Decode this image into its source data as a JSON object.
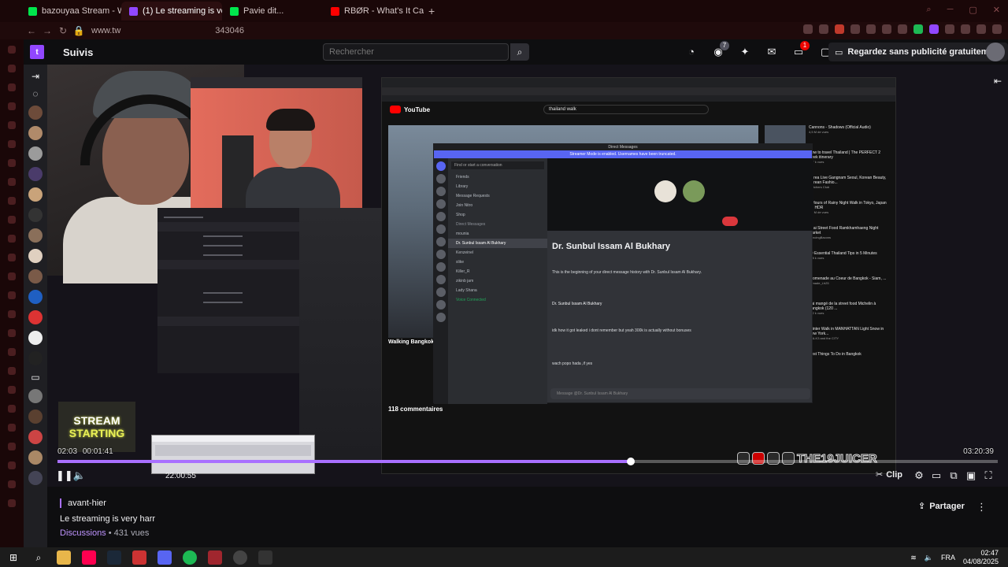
{
  "browser": {
    "tabs": [
      {
        "label": "bazouyaa Stream - Watch",
        "favicon_color": "#00e64d"
      },
      {
        "label": "(1) Le streaming is ver",
        "favicon_color": "#9147ff"
      },
      {
        "label": "Pavie dit...",
        "favicon_color": "#00e64d"
      },
      {
        "label": "RBØR - What's It Called (",
        "favicon_color": "#ff0000"
      }
    ],
    "new_tab": "+",
    "url_left": "www.tw",
    "url_right": "343046"
  },
  "twitch": {
    "nav": {
      "follow_label": "Suivis",
      "search_placeholder": "Rechercher",
      "notifications_count": "7",
      "inbox_count": "1",
      "prime_label": "Regardez sans publicité gratuitement"
    },
    "player": {
      "overlay_card_line1": "STREAM",
      "overlay_card_line2": "STARTING",
      "hover_time": "00:01:41",
      "elapsed_overlay": "02:03",
      "current_time": "22:00:55",
      "duration": "03:20:39",
      "progress": 0.61,
      "clip_label": "Clip",
      "watermark": "THE19JUICER"
    },
    "shared_screen": {
      "youtube_word": "YouTube",
      "youtube_search": "thailand walk",
      "video_title": "Walking Bangkok",
      "comments_count": "118 commentaires",
      "recommendations": [
        {
          "title": "Cannons - Shadows (Official Audio)",
          "meta": "4,5 M de vues"
        },
        {
          "title": "How to travel Thailand | The PERFECT 2 week itinerary",
          "meta": "737 k vues"
        },
        {
          "title": "Korea Live Gangnam Seoul, Korean Beauty, Korean Fashio...",
          "meta": "Watchers Club"
        },
        {
          "title": "3 Hours of Rainy Night Walk in Tokyo, Japan 4K HDR",
          "meta": "1,2 M de vues"
        },
        {
          "title": "Thai Street Food Ramkhamhaeng Night Market",
          "meta": "DancingBacons"
        },
        {
          "title": "10 Essential Thailand Tips in 5 Minutes",
          "meta": "148 k vues"
        },
        {
          "title": "Promenade au Coeur de Bangkok - Siam, ...",
          "meta": "nomade_Lh25"
        },
        {
          "title": "J'ai mangé de la street food Michelin à Bangkok (120 ...",
          "meta": "922 k vues"
        },
        {
          "title": "Winter Walk in MANHATTAN Light Snow in New York...",
          "meta": "WALK3 and the CITY"
        },
        {
          "title": "Best Things To Do in Bangkok",
          "meta": ""
        }
      ],
      "discord": {
        "title_bar": "Direct Messages",
        "banner": "Streamer Mode is enabled. Usernames have been truncated.",
        "find_placeholder": "Find or start a conversation",
        "menu": [
          "Friends",
          "Library",
          "Message Requests",
          "Join Nitro",
          "Shop"
        ],
        "dm_header": "Direct Messages",
        "dms": [
          "mounia",
          "Dr. Sunbul Issam Al Bukhary",
          "Kenzeinel",
          "slike",
          "Killer_R",
          "zikinb jam",
          "Lady Shana"
        ],
        "voice_status": "Voice Connected",
        "chat_name": "Dr. Sunbul Issam Al Bukhary",
        "chat_intro": "This is the beginning of your direct message history with Dr. Sunbul Issam Al Bukhary.",
        "message_1": "Dr. Sunbul Issam Al Bukhary",
        "message_2": "idk how it got leaked i dont remember but yeah 300k is actually without bonuses",
        "message_3": "wach popo hada ,if yes",
        "input_placeholder": "Message @Dr. Sunbul Issam Al Bukhary"
      }
    },
    "info": {
      "date": "avant-hier",
      "title": "Le streaming is very harr",
      "category": "Discussions",
      "views": "431 vues",
      "share_label": "Partager"
    }
  },
  "taskbar": {
    "lang": "FRA",
    "time": "02:47",
    "date": "04/08/2025"
  },
  "colors": {
    "twitch_purple": "#9147ff",
    "progress": "#a970ff",
    "notification_red": "#eb0400"
  }
}
